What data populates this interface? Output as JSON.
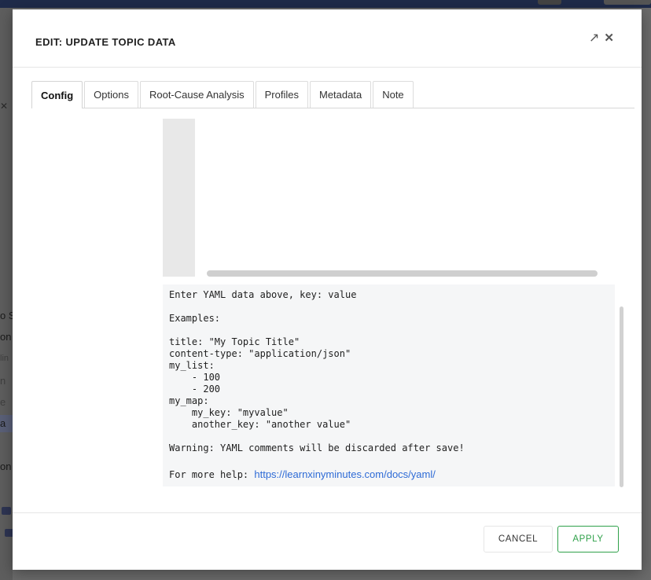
{
  "background": {
    "fragments": [
      "o S",
      "on",
      "lin",
      "n",
      "e",
      "a",
      "on"
    ]
  },
  "modal": {
    "title": "EDIT: UPDATE TOPIC DATA",
    "tabs": [
      {
        "label": "Config",
        "active": true
      },
      {
        "label": "Options",
        "active": false
      },
      {
        "label": "Root-Cause Analysis",
        "active": false
      },
      {
        "label": "Profiles",
        "active": false
      },
      {
        "label": "Metadata",
        "active": false
      },
      {
        "label": "Note",
        "active": false
      }
    ],
    "help_text": "Enter YAML data above, key: value\n\nExamples:\n\ntitle: \"My Topic Title\"\ncontent-type: \"application/json\"\nmy_list:\n    - 100\n    - 200\nmy_map:\n    my_key: \"myvalue\"\n    another_key: \"another value\"\n\nWarning: YAML comments will be discarded after save!",
    "help_prefix": "For more help: ",
    "help_link": "https://learnxinyminutes.com/docs/yaml/",
    "cancel_label": "CANCEL",
    "apply_label": "APPLY"
  },
  "icons": {
    "expand": "arrow-up-right-icon",
    "close": "close-icon"
  },
  "colors": {
    "apply_accent": "#2fa14a",
    "link": "#2e6bd6",
    "topbar": "#1f2b4a"
  }
}
